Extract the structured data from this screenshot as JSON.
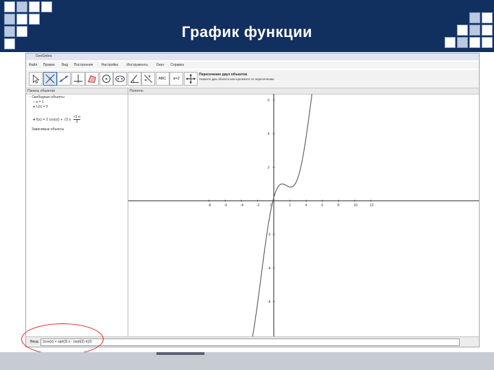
{
  "slide": {
    "title": "График функции",
    "header_color": "#12305f",
    "footer_color": "#c7ccd3"
  },
  "window": {
    "app_title": "GeoGebra",
    "menu": [
      "Файл",
      "Правка",
      "Вид",
      "Построения",
      "Настройки",
      "Инструменты",
      "Окно",
      "Справка"
    ],
    "tools": [
      {
        "icon": "move-arrow-icon"
      },
      {
        "icon": "intersect-two-objects-icon",
        "active": true
      },
      {
        "icon": "line-through-two-points-icon"
      },
      {
        "icon": "perpendicular-line-icon"
      },
      {
        "icon": "polygon-icon"
      },
      {
        "icon": "circle-with-center-icon"
      },
      {
        "icon": "ellipse-icon"
      },
      {
        "icon": "angle-icon"
      },
      {
        "icon": "reflect-about-line-icon"
      },
      {
        "icon": "insert-text-icon",
        "label": "ABC"
      },
      {
        "icon": "slider-icon",
        "label": "a=2"
      },
      {
        "icon": "move-graphics-view-icon"
      }
    ],
    "tool_info": {
      "title": "Пересечение двух объектов",
      "description": "Укажите два объекта или щелкните по пересечению"
    },
    "algebra": {
      "header": "Панель объектов",
      "free_objects_label": "Свободные объекты",
      "items": [
        "a = 1",
        "f₁(x) = 0",
        "f(x) = 2 cos(x) + √3 x"
      ],
      "sqrt3_over_3_num": "√3 π",
      "sqrt3_over_3_den": "3",
      "dependent_objects_label": "Зависимые объекты"
    },
    "graphics": {
      "header": "Полотно",
      "x_ticks": [
        -8,
        -6,
        -4,
        -2,
        0,
        2,
        4,
        6,
        8,
        10,
        12
      ],
      "y_ticks": [
        -6,
        -4,
        -2,
        2,
        4,
        6
      ],
      "curve_color": "#555555"
    },
    "input": {
      "label": "Ввод:",
      "value": "2cos(x) + sqrt(3) x - (sqrt(3) π)/3"
    }
  }
}
